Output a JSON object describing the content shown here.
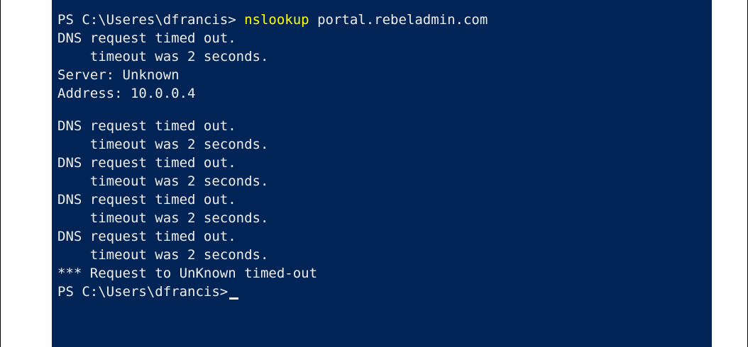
{
  "colors": {
    "console_background": "#012456",
    "console_text": "#eeedf0",
    "command_text": "#ffff00",
    "page_background": "#ffffff"
  },
  "console": {
    "lines": [
      {
        "prompt": "PS C:\\Useres\\dfrancis> ",
        "command": "nslookup",
        "args": " portal.rebeladmin.com"
      },
      {
        "text": "DNS request timed out."
      },
      {
        "text": "    timeout was 2 seconds."
      },
      {
        "text": "Server: Unknown"
      },
      {
        "text": "Address: 10.0.0.4"
      },
      {
        "text": "DNS request timed out."
      },
      {
        "text": "    timeout was 2 seconds."
      },
      {
        "text": "DNS request timed out."
      },
      {
        "text": "    timeout was 2 seconds."
      },
      {
        "text": "DNS request timed out."
      },
      {
        "text": "    timeout was 2 seconds."
      },
      {
        "text": "DNS request timed out."
      },
      {
        "text": "    timeout was 2 seconds."
      },
      {
        "text": "*** Request to UnKnown timed-out"
      },
      {
        "prompt": "PS C:\\Users\\dfrancis>"
      }
    ]
  }
}
